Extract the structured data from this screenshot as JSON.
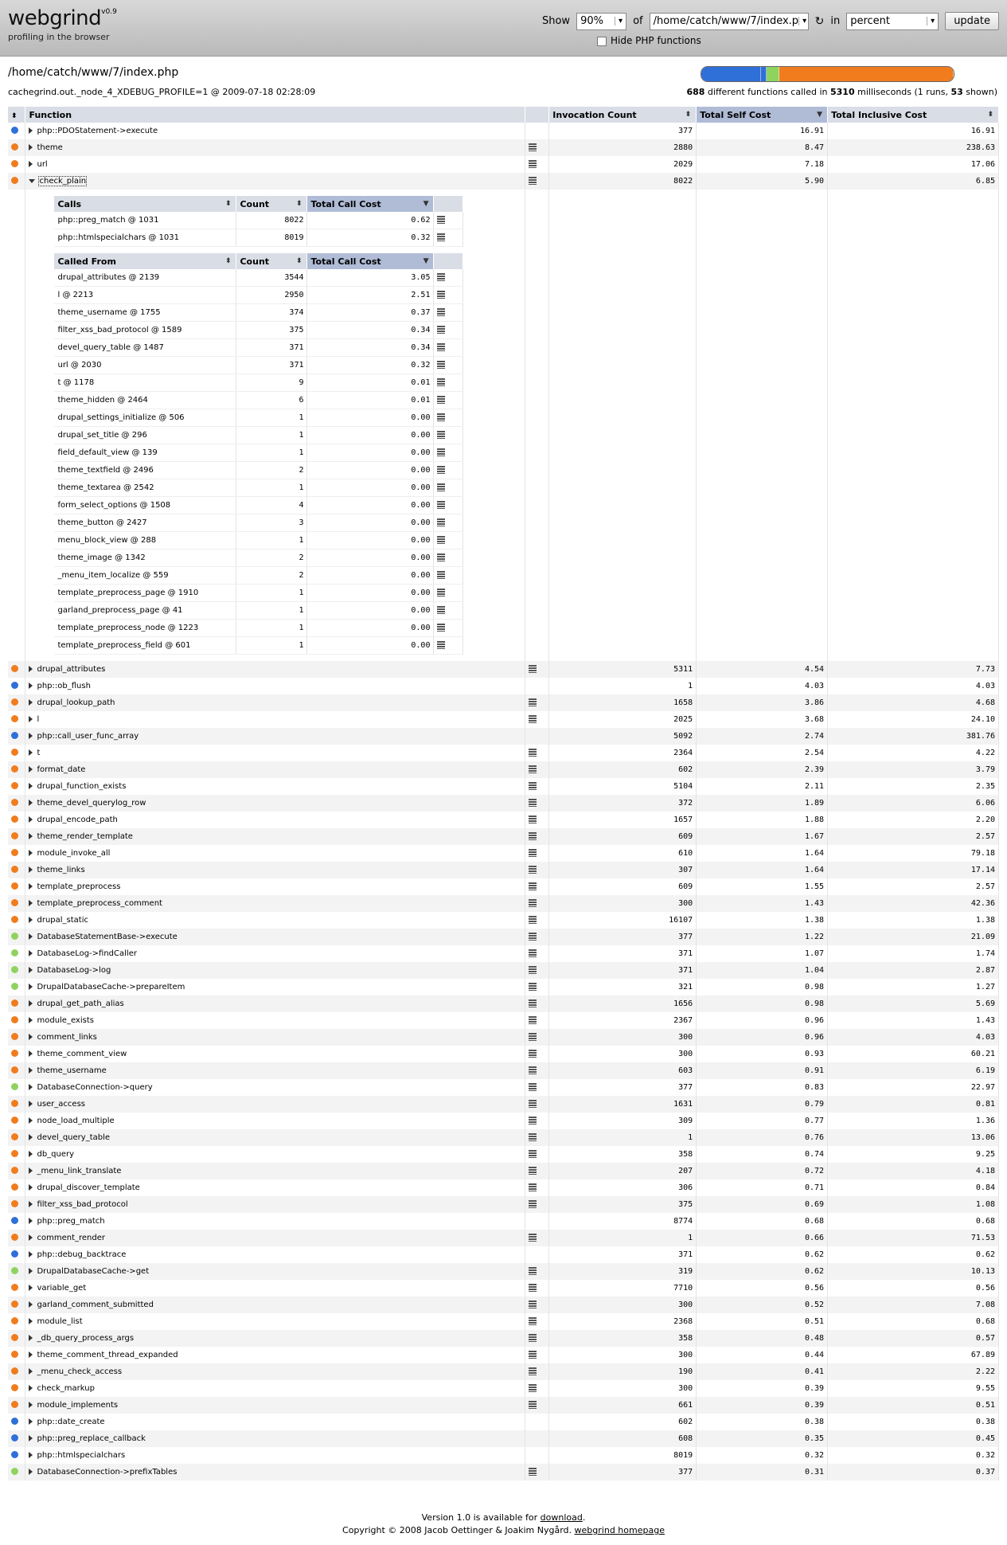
{
  "header": {
    "logo": "webgrind",
    "version": "v0.9",
    "tagline": "profiling in the browser",
    "show_label": "Show",
    "show_value": "90%",
    "of_label": "of",
    "file_value": "/home/catch/www/7/index.p",
    "in_label": "in",
    "unit_value": "percent",
    "update_label": "update",
    "hide_php_label": "Hide PHP functions"
  },
  "info": {
    "file_path": "/home/catch/www/7/index.php",
    "profile": "cachegrind.out._node_4_XDEBUG_PROFILE=1 @ 2009-07-18 02:28:09",
    "stats_n1": "688",
    "stats_t1": " different functions called in ",
    "stats_n2": "5310",
    "stats_t2": " milliseconds (1 runs, ",
    "stats_n3": "53",
    "stats_t3": " shown)"
  },
  "colors": {
    "blue": "#2f6fd8",
    "orange": "#f07c1e",
    "green": "#8fd35f"
  },
  "bar_segments": [
    {
      "color": "#2f6fd8",
      "frac": 0.235
    },
    {
      "color": "#2f6fd8",
      "frac": 0.02
    },
    {
      "color": "#8fd35f",
      "frac": 0.05
    },
    {
      "color": "#f07c1e",
      "frac": 0.695
    }
  ],
  "columns": {
    "function": "Function",
    "invocation": "Invocation Count",
    "self": "Total Self Cost",
    "inclusive": "Total Inclusive Cost"
  },
  "rows": [
    {
      "c": "blue",
      "name": "php::PDOStatement->execute",
      "file": false,
      "inv": "377",
      "self": "16.91",
      "incl": "16.91"
    },
    {
      "c": "orange",
      "name": "theme",
      "file": true,
      "inv": "2880",
      "self": "8.47",
      "incl": "238.63"
    },
    {
      "c": "orange",
      "name": "url",
      "file": true,
      "inv": "2029",
      "self": "7.18",
      "incl": "17.06"
    },
    {
      "c": "orange",
      "name": "check_plain",
      "file": true,
      "inv": "8022",
      "self": "5.90",
      "incl": "6.85",
      "expanded": true
    },
    {
      "c": "orange",
      "name": "drupal_attributes",
      "file": true,
      "inv": "5311",
      "self": "4.54",
      "incl": "7.73"
    },
    {
      "c": "blue",
      "name": "php::ob_flush",
      "file": false,
      "inv": "1",
      "self": "4.03",
      "incl": "4.03"
    },
    {
      "c": "orange",
      "name": "drupal_lookup_path",
      "file": true,
      "inv": "1658",
      "self": "3.86",
      "incl": "4.68"
    },
    {
      "c": "orange",
      "name": "l",
      "file": true,
      "inv": "2025",
      "self": "3.68",
      "incl": "24.10"
    },
    {
      "c": "blue",
      "name": "php::call_user_func_array",
      "file": false,
      "inv": "5092",
      "self": "2.74",
      "incl": "381.76"
    },
    {
      "c": "orange",
      "name": "t",
      "file": true,
      "inv": "2364",
      "self": "2.54",
      "incl": "4.22"
    },
    {
      "c": "orange",
      "name": "format_date",
      "file": true,
      "inv": "602",
      "self": "2.39",
      "incl": "3.79"
    },
    {
      "c": "orange",
      "name": "drupal_function_exists",
      "file": true,
      "inv": "5104",
      "self": "2.11",
      "incl": "2.35"
    },
    {
      "c": "orange",
      "name": "theme_devel_querylog_row",
      "file": true,
      "inv": "372",
      "self": "1.89",
      "incl": "6.06"
    },
    {
      "c": "orange",
      "name": "drupal_encode_path",
      "file": true,
      "inv": "1657",
      "self": "1.88",
      "incl": "2.20"
    },
    {
      "c": "orange",
      "name": "theme_render_template",
      "file": true,
      "inv": "609",
      "self": "1.67",
      "incl": "2.57"
    },
    {
      "c": "orange",
      "name": "module_invoke_all",
      "file": true,
      "inv": "610",
      "self": "1.64",
      "incl": "79.18"
    },
    {
      "c": "orange",
      "name": "theme_links",
      "file": true,
      "inv": "307",
      "self": "1.64",
      "incl": "17.14"
    },
    {
      "c": "orange",
      "name": "template_preprocess",
      "file": true,
      "inv": "609",
      "self": "1.55",
      "incl": "2.57"
    },
    {
      "c": "orange",
      "name": "template_preprocess_comment",
      "file": true,
      "inv": "300",
      "self": "1.43",
      "incl": "42.36"
    },
    {
      "c": "orange",
      "name": "drupal_static",
      "file": true,
      "inv": "16107",
      "self": "1.38",
      "incl": "1.38"
    },
    {
      "c": "green",
      "name": "DatabaseStatementBase->execute",
      "file": true,
      "inv": "377",
      "self": "1.22",
      "incl": "21.09"
    },
    {
      "c": "green",
      "name": "DatabaseLog->findCaller",
      "file": true,
      "inv": "371",
      "self": "1.07",
      "incl": "1.74"
    },
    {
      "c": "green",
      "name": "DatabaseLog->log",
      "file": true,
      "inv": "371",
      "self": "1.04",
      "incl": "2.87"
    },
    {
      "c": "green",
      "name": "DrupalDatabaseCache->prepareItem",
      "file": true,
      "inv": "321",
      "self": "0.98",
      "incl": "1.27"
    },
    {
      "c": "orange",
      "name": "drupal_get_path_alias",
      "file": true,
      "inv": "1656",
      "self": "0.98",
      "incl": "5.69"
    },
    {
      "c": "orange",
      "name": "module_exists",
      "file": true,
      "inv": "2367",
      "self": "0.96",
      "incl": "1.43"
    },
    {
      "c": "orange",
      "name": "comment_links",
      "file": true,
      "inv": "300",
      "self": "0.96",
      "incl": "4.03"
    },
    {
      "c": "orange",
      "name": "theme_comment_view",
      "file": true,
      "inv": "300",
      "self": "0.93",
      "incl": "60.21"
    },
    {
      "c": "orange",
      "name": "theme_username",
      "file": true,
      "inv": "603",
      "self": "0.91",
      "incl": "6.19"
    },
    {
      "c": "green",
      "name": "DatabaseConnection->query",
      "file": true,
      "inv": "377",
      "self": "0.83",
      "incl": "22.97"
    },
    {
      "c": "orange",
      "name": "user_access",
      "file": true,
      "inv": "1631",
      "self": "0.79",
      "incl": "0.81"
    },
    {
      "c": "orange",
      "name": "node_load_multiple",
      "file": true,
      "inv": "309",
      "self": "0.77",
      "incl": "1.36"
    },
    {
      "c": "orange",
      "name": "devel_query_table",
      "file": true,
      "inv": "1",
      "self": "0.76",
      "incl": "13.06"
    },
    {
      "c": "orange",
      "name": "db_query",
      "file": true,
      "inv": "358",
      "self": "0.74",
      "incl": "9.25"
    },
    {
      "c": "orange",
      "name": "_menu_link_translate",
      "file": true,
      "inv": "207",
      "self": "0.72",
      "incl": "4.18"
    },
    {
      "c": "orange",
      "name": "drupal_discover_template",
      "file": true,
      "inv": "306",
      "self": "0.71",
      "incl": "0.84"
    },
    {
      "c": "orange",
      "name": "filter_xss_bad_protocol",
      "file": true,
      "inv": "375",
      "self": "0.69",
      "incl": "1.08"
    },
    {
      "c": "blue",
      "name": "php::preg_match",
      "file": false,
      "inv": "8774",
      "self": "0.68",
      "incl": "0.68"
    },
    {
      "c": "orange",
      "name": "comment_render",
      "file": true,
      "inv": "1",
      "self": "0.66",
      "incl": "71.53"
    },
    {
      "c": "blue",
      "name": "php::debug_backtrace",
      "file": false,
      "inv": "371",
      "self": "0.62",
      "incl": "0.62"
    },
    {
      "c": "green",
      "name": "DrupalDatabaseCache->get",
      "file": true,
      "inv": "319",
      "self": "0.62",
      "incl": "10.13"
    },
    {
      "c": "orange",
      "name": "variable_get",
      "file": true,
      "inv": "7710",
      "self": "0.56",
      "incl": "0.56"
    },
    {
      "c": "orange",
      "name": "garland_comment_submitted",
      "file": true,
      "inv": "300",
      "self": "0.52",
      "incl": "7.08"
    },
    {
      "c": "orange",
      "name": "module_list",
      "file": true,
      "inv": "2368",
      "self": "0.51",
      "incl": "0.68"
    },
    {
      "c": "orange",
      "name": "_db_query_process_args",
      "file": true,
      "inv": "358",
      "self": "0.48",
      "incl": "0.57"
    },
    {
      "c": "orange",
      "name": "theme_comment_thread_expanded",
      "file": true,
      "inv": "300",
      "self": "0.44",
      "incl": "67.89"
    },
    {
      "c": "orange",
      "name": "_menu_check_access",
      "file": true,
      "inv": "190",
      "self": "0.41",
      "incl": "2.22"
    },
    {
      "c": "orange",
      "name": "check_markup",
      "file": true,
      "inv": "300",
      "self": "0.39",
      "incl": "9.55"
    },
    {
      "c": "orange",
      "name": "module_implements",
      "file": true,
      "inv": "661",
      "self": "0.39",
      "incl": "0.51"
    },
    {
      "c": "blue",
      "name": "php::date_create",
      "file": false,
      "inv": "602",
      "self": "0.38",
      "incl": "0.38"
    },
    {
      "c": "blue",
      "name": "php::preg_replace_callback",
      "file": false,
      "inv": "608",
      "self": "0.35",
      "incl": "0.45"
    },
    {
      "c": "blue",
      "name": "php::htmlspecialchars",
      "file": false,
      "inv": "8019",
      "self": "0.32",
      "incl": "0.32"
    },
    {
      "c": "green",
      "name": "DatabaseConnection->prefixTables",
      "file": true,
      "inv": "377",
      "self": "0.31",
      "incl": "0.37"
    }
  ],
  "calls": {
    "h1": "Calls",
    "h2": "Count",
    "h3": "Total Call Cost",
    "rows": [
      {
        "name": "php::preg_match @ 1031",
        "count": "8022",
        "cost": "0.62"
      },
      {
        "name": "php::htmlspecialchars @ 1031",
        "count": "8019",
        "cost": "0.32"
      }
    ]
  },
  "called_from": {
    "h1": "Called From",
    "h2": "Count",
    "h3": "Total Call Cost",
    "rows": [
      {
        "name": "drupal_attributes @ 2139",
        "count": "3544",
        "cost": "3.05"
      },
      {
        "name": "l @ 2213",
        "count": "2950",
        "cost": "2.51"
      },
      {
        "name": "theme_username @ 1755",
        "count": "374",
        "cost": "0.37"
      },
      {
        "name": "filter_xss_bad_protocol @ 1589",
        "count": "375",
        "cost": "0.34"
      },
      {
        "name": "devel_query_table @ 1487",
        "count": "371",
        "cost": "0.34"
      },
      {
        "name": "url @ 2030",
        "count": "371",
        "cost": "0.32"
      },
      {
        "name": "t @ 1178",
        "count": "9",
        "cost": "0.01"
      },
      {
        "name": "theme_hidden @ 2464",
        "count": "6",
        "cost": "0.01"
      },
      {
        "name": "drupal_settings_initialize @ 506",
        "count": "1",
        "cost": "0.00"
      },
      {
        "name": "drupal_set_title @ 296",
        "count": "1",
        "cost": "0.00"
      },
      {
        "name": "field_default_view @ 139",
        "count": "1",
        "cost": "0.00"
      },
      {
        "name": "theme_textfield @ 2496",
        "count": "2",
        "cost": "0.00"
      },
      {
        "name": "theme_textarea @ 2542",
        "count": "1",
        "cost": "0.00"
      },
      {
        "name": "form_select_options @ 1508",
        "count": "4",
        "cost": "0.00"
      },
      {
        "name": "theme_button @ 2427",
        "count": "3",
        "cost": "0.00"
      },
      {
        "name": "menu_block_view @ 288",
        "count": "1",
        "cost": "0.00"
      },
      {
        "name": "theme_image @ 1342",
        "count": "2",
        "cost": "0.00"
      },
      {
        "name": "_menu_item_localize @ 559",
        "count": "2",
        "cost": "0.00"
      },
      {
        "name": "template_preprocess_page @ 1910",
        "count": "1",
        "cost": "0.00"
      },
      {
        "name": "garland_preprocess_page @ 41",
        "count": "1",
        "cost": "0.00"
      },
      {
        "name": "template_preprocess_node @ 1223",
        "count": "1",
        "cost": "0.00"
      },
      {
        "name": "template_preprocess_field @ 601",
        "count": "1",
        "cost": "0.00"
      }
    ]
  },
  "footer": {
    "line1a": "Version 1.0 is available for ",
    "download": "download",
    "line1b": ".",
    "line2a": "Copyright © 2008 Jacob Oettinger & Joakim Nygård. ",
    "homepage": "webgrind homepage"
  }
}
